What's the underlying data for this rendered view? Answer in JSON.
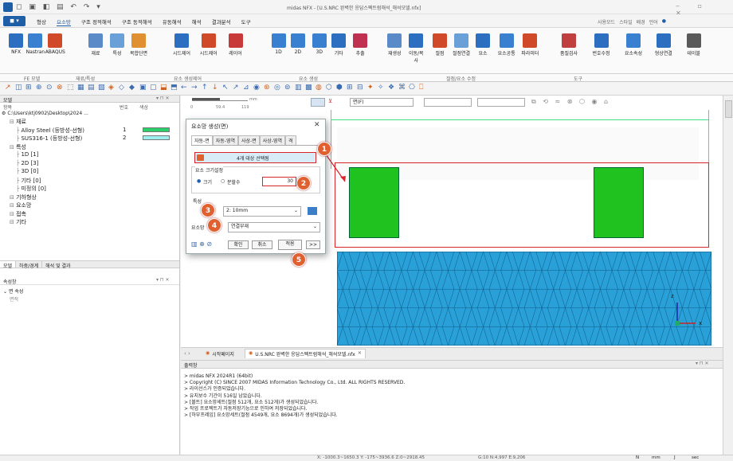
{
  "app": {
    "title": "midas NFX - [U.S.NRC 완벽한 응답스펙트럼해석_해석모델.nfx]",
    "search_label": "사용모드",
    "style_label": "스타일",
    "bg_label": "배경",
    "lang_label": "언어"
  },
  "menu": {
    "items": [
      "형상",
      "요소망",
      "구조 정적해석",
      "구조 동적해석",
      "유동해석",
      "해석",
      "결과분석",
      "도구"
    ]
  },
  "ribbon": {
    "buttons": [
      "NFX",
      "Nastran",
      "ABAQUS",
      "재료",
      "특성",
      "복합단면",
      "시드제어",
      "시드제어",
      "레이어",
      "1D",
      "2D",
      "3D",
      "기타",
      "추출",
      "재생성",
      "이동/복사",
      "절점",
      "절점연결",
      "요소",
      "요소공통",
      "파라미터",
      "품질검사",
      "번호수정",
      "요소속성",
      "형상연결",
      "테이블"
    ],
    "groups": [
      "FE 모델",
      "재료/특성",
      "요소 생성제어",
      "요소 생성",
      "절점/요소 수정",
      "도구"
    ]
  },
  "left": {
    "panel_title": "모델",
    "col_headers": [
      "항목",
      "번호",
      "색상"
    ],
    "path": "C:\\Users\\ktj0902\\Desktop\\2024 ...",
    "tree": [
      {
        "label": "재료",
        "indent": 1
      },
      {
        "label": "Alloy Steel (등방성-선형)",
        "num": "1",
        "indent": 2,
        "color": "#2bd06a"
      },
      {
        "label": "SUS316-1 (등방성-선형)",
        "num": "2",
        "indent": 2,
        "color": "#9ef0f0"
      },
      {
        "label": "특성",
        "indent": 1
      },
      {
        "label": "1D [1]",
        "indent": 2
      },
      {
        "label": "2D [3]",
        "indent": 2
      },
      {
        "label": "3D [0]",
        "indent": 2
      },
      {
        "label": "기타 [0]",
        "indent": 2
      },
      {
        "label": "미정의 [0]",
        "indent": 2
      },
      {
        "label": "기하형상",
        "indent": 1
      },
      {
        "label": "요소망",
        "indent": 1
      },
      {
        "label": "접촉",
        "indent": 1
      },
      {
        "label": "기타",
        "indent": 1
      }
    ],
    "tabs": [
      "모델",
      "하중/경계",
      "해석 및 결과"
    ],
    "props_title": "속성창",
    "props_section": "면 속성",
    "props_item": "면적"
  },
  "viewport": {
    "ruler_labels": [
      "0",
      "59.4",
      "119"
    ],
    "ruler_unit": "mm",
    "filter": "면(F)",
    "axis_z": "z",
    "axis_x": "x"
  },
  "dialog": {
    "title": "요소망 생성(면)",
    "tabs": [
      "자동-면",
      "자동-영역",
      "사상-면",
      "사상-영역",
      "격"
    ],
    "selection_text": "4개 대상 선택됨",
    "size_group": "요소 크기설정",
    "radio_size": "크기",
    "radio_div": "분할수",
    "size_value": "30",
    "prop_label": "특성",
    "prop_value": "2: 10mm",
    "mesh_label": "요소망",
    "mesh_value": "연결부재",
    "ok": "확인",
    "cancel": "취소",
    "apply": "적용",
    "more": ">>"
  },
  "badges": [
    "1",
    "2",
    "3",
    "4",
    "5"
  ],
  "doc_tabs": [
    "시작페이지",
    "U.S.NRC 완벽한 응답스펙트럼해석_해석모델.nfx"
  ],
  "output": {
    "title": "출력창",
    "lines": [
      "> midas NFX 2024R1 (64bit)",
      "> Copyright (C) SINCE 2007 MIDAS Information Technology Co., Ltd. ALL RIGHTS RESERVED.",
      "> 라이선스가 인증되었습니다.",
      "> 유지보수 기간이 516일 남았습니다.",
      "> [볼트] 요소망세트(절점 512개, 요소 512개)가 생성되었습니다.",
      "> 작업 프로젝트가 자동저장기능으로 인하여 저장되었습니다.",
      "> [하부프레임] 요소망세트(절점 4549개, 요소 8694개)가 생성되었습니다."
    ]
  },
  "status": {
    "coords": "X: -1000.3~1650.3 Y: -175~3936.6 Z:0~2918.45",
    "grid": "G:10  N:4,997  E:9,206",
    "unit_n": "N",
    "unit_mm": "mm",
    "unit_j": "J",
    "unit_sec": "sec"
  },
  "colors": {
    "accent": "#1e5fa8",
    "highlight_red": "#d8242a",
    "badge": "#e06030",
    "mesh_blue": "#2aa0d8",
    "green_block": "#1fc21f"
  }
}
